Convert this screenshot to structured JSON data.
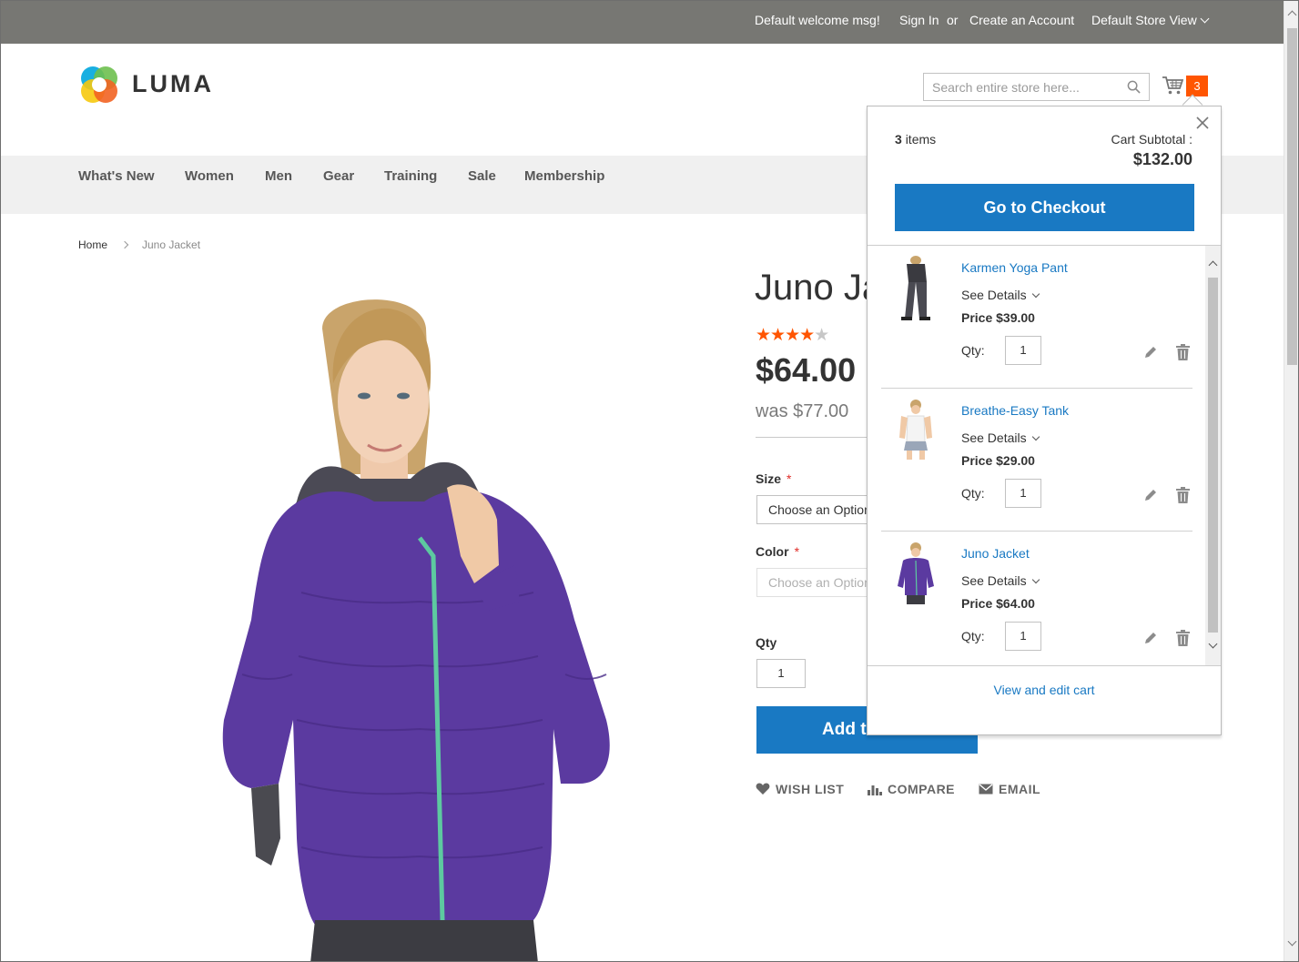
{
  "topbar": {
    "welcome": "Default welcome msg!",
    "sign_in": "Sign In",
    "or": "or",
    "create_account": "Create an Account",
    "store_view": "Default Store View"
  },
  "header": {
    "logo_text": "LUMA",
    "search_placeholder": "Search entire store here...",
    "cart_count": "3"
  },
  "nav": {
    "items": [
      "What's New",
      "Women",
      "Men",
      "Gear",
      "Training",
      "Sale",
      "Membership"
    ]
  },
  "breadcrumb": {
    "home": "Home",
    "current": "Juno Jacket"
  },
  "product": {
    "title": "Juno Jacket",
    "rating_stars": 4.5,
    "price": "$64.00",
    "old_price": "was $77.00",
    "size_label": "Size",
    "size_placeholder": "Choose an Option...",
    "color_label": "Color",
    "color_placeholder": "Choose an Option...",
    "required_mark": "*",
    "qty_label": "Qty",
    "qty_value": "1",
    "add_to_cart": "Add to Cart",
    "wish_list": "WISH LIST",
    "compare": "COMPARE",
    "email": "EMAIL"
  },
  "minicart": {
    "items_count": "3",
    "items_label": "items",
    "subtotal_label": "Cart Subtotal :",
    "subtotal_value": "$132.00",
    "checkout_label": "Go to Checkout",
    "see_details": "See Details",
    "price_label": "Price",
    "qty_label": "Qty:",
    "view_edit": "View and edit cart",
    "items": [
      {
        "name": "Karmen Yoga Pant",
        "price": "$39.00",
        "qty": "1"
      },
      {
        "name": "Breathe-Easy Tank",
        "price": "$29.00",
        "qty": "1"
      },
      {
        "name": "Juno Jacket",
        "price": "$64.00",
        "qty": "1"
      }
    ]
  },
  "colors": {
    "accent_blue": "#1979c3",
    "badge_orange": "#ff5501",
    "topbar_gray": "#777773",
    "jacket_purple": "#5b3aa0"
  }
}
